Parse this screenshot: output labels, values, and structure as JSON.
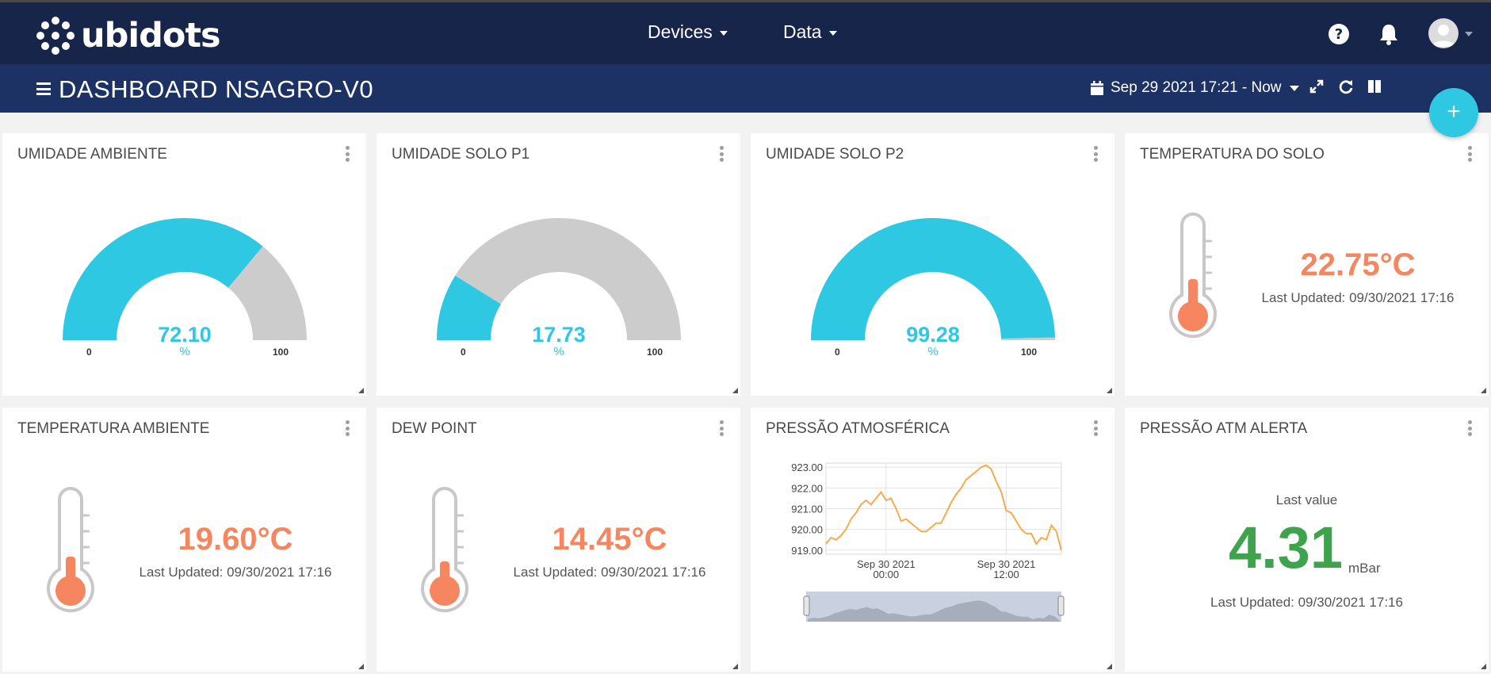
{
  "nav": {
    "logo_text": "ubidots",
    "menus": [
      {
        "label": "Devices"
      },
      {
        "label": "Data"
      }
    ],
    "icons": [
      "help-icon",
      "bell-icon",
      "avatar"
    ]
  },
  "dashboard": {
    "title": "DASHBOARD NSAGRO-V0",
    "date_range": "Sep 29 2021 17:21 - Now",
    "toolbar_icons": [
      "calendar-icon",
      "fullscreen-icon",
      "refresh-icon",
      "columns-icon"
    ],
    "fab_label": "+"
  },
  "colors": {
    "navbar": "#17254a",
    "subbar": "#1c3264",
    "gauge_fill": "#2ec8e2",
    "gauge_track": "#cccccc",
    "thermometer": "#f5865f",
    "alert_value": "#3fa34d",
    "line": "#f6ab4a"
  },
  "widgets": {
    "umidade_ambiente": {
      "title": "UMIDADE AMBIENTE",
      "value": "72.10",
      "unit": "%",
      "min": "0",
      "max": "100",
      "level": 0.721
    },
    "umidade_solo_p1": {
      "title": "UMIDADE SOLO P1",
      "value": "17.73",
      "unit": "%",
      "min": "0",
      "max": "100",
      "level": 0.1773
    },
    "umidade_solo_p2": {
      "title": "UMIDADE SOLO P2",
      "value": "99.28",
      "unit": "%",
      "min": "0",
      "max": "100",
      "level": 0.9928
    },
    "temperatura_solo": {
      "title": "TEMPERATURA DO SOLO",
      "value": "22.75°C",
      "updated": "Last Updated: 09/30/2021 17:16"
    },
    "temperatura_ambiente": {
      "title": "TEMPERATURA AMBIENTE",
      "value": "19.60°C",
      "updated": "Last Updated: 09/30/2021 17:16"
    },
    "dew_point": {
      "title": "DEW POINT",
      "value": "14.45°C",
      "updated": "Last Updated: 09/30/2021 17:16"
    },
    "pressao_atm": {
      "title": "PRESSÃO ATMOSFÉRICA"
    },
    "pressao_alerta": {
      "title": "PRESSÃO ATM ALERTA",
      "label": "Last value",
      "value": "4.31",
      "unit": "mBar",
      "updated": "Last Updated: 09/30/2021 17:16"
    }
  },
  "chart_data": {
    "type": "line",
    "title": "PRESSÃO ATMOSFÉRICA",
    "xlabel": "",
    "ylabel": "",
    "ylim": [
      918.8,
      923.2
    ],
    "yticks": [
      "923.00",
      "922.00",
      "921.00",
      "920.00",
      "919.00"
    ],
    "xticks": [
      {
        "line1": "Sep 30 2021",
        "line2": "00:00",
        "x": 6
      },
      {
        "line1": "Sep 30 2021",
        "line2": "12:00",
        "x": 18
      }
    ],
    "xlim": [
      0,
      23.5
    ],
    "grid": true,
    "series": [
      {
        "x": [
          0,
          0.5,
          1,
          1.5,
          2,
          2.5,
          3,
          3.5,
          4,
          4.5,
          5,
          5.5,
          6,
          6.5,
          7,
          7.5,
          8,
          8.5,
          9,
          9.5,
          10,
          10.5,
          11,
          11.5,
          12,
          12.5,
          13,
          13.5,
          14,
          14.5,
          15,
          15.5,
          16,
          16.5,
          17,
          17.5,
          18,
          18.5,
          19,
          19.5,
          20,
          20.5,
          21,
          21.5,
          22,
          22.5,
          23,
          23.5
        ],
        "values": [
          919.3,
          919.6,
          919.5,
          919.7,
          920.0,
          920.5,
          920.8,
          921.2,
          921.4,
          921.2,
          921.5,
          921.8,
          921.4,
          921.5,
          921.0,
          920.4,
          920.5,
          920.3,
          920.1,
          919.9,
          919.9,
          920.1,
          920.3,
          920.3,
          920.8,
          921.3,
          921.7,
          922.0,
          922.4,
          922.6,
          922.8,
          923.0,
          923.1,
          922.9,
          922.3,
          921.8,
          920.9,
          920.8,
          920.4,
          920.0,
          919.8,
          919.8,
          919.3,
          919.6,
          919.5,
          920.2,
          919.9,
          919.0
        ]
      }
    ]
  }
}
